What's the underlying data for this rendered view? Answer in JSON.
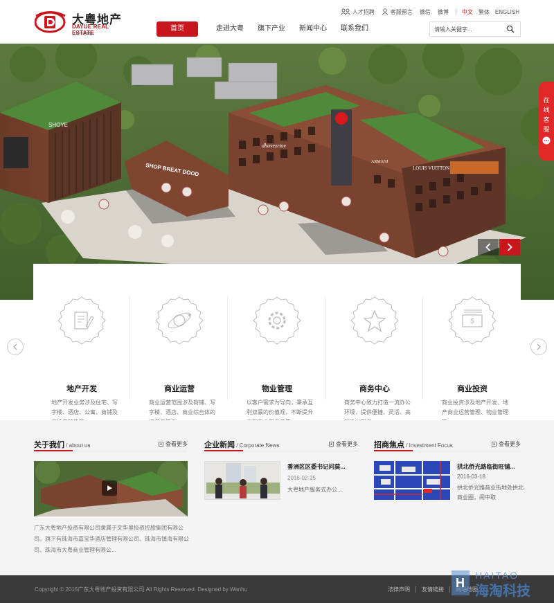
{
  "brand": {
    "name_cn": "大粤地产",
    "name_en": "DAYUE REAL ESTATE",
    "slogan": "让城市更精彩"
  },
  "toplinks": {
    "recruit": "人才招聘",
    "message": "客服留言",
    "wechat": "微信",
    "weibo": "微博",
    "lang_cn": "中文",
    "lang_tw": "繁体",
    "lang_en": "ENGLISH"
  },
  "nav": {
    "items": [
      {
        "label": "首页"
      },
      {
        "label": "走进大粤"
      },
      {
        "label": "旗下产业"
      },
      {
        "label": "新闻中心"
      },
      {
        "label": "联系我们"
      }
    ]
  },
  "search": {
    "placeholder": "请输入关键字..."
  },
  "side_service": {
    "chars": [
      "在",
      "线",
      "客",
      "服"
    ]
  },
  "banner": {
    "signs": {
      "shop": "SHOP BREAT DOOD",
      "store": "SHOYE",
      "lv": "LOUIS VUITTON",
      "armani": "ARMANI",
      "brand": "dhovezrtov"
    }
  },
  "business": [
    {
      "title": "地产开发",
      "desc": "地产开发业务涉及住宅、写字楼、酒店、公寓、商铺及房地产销售等。",
      "icon": "document-pen-icon"
    },
    {
      "title": "商业运营",
      "desc": "商业运营范围涉及商铺、写字楼、酒店、商业综合体的运营与策划。",
      "icon": "orbit-icon"
    },
    {
      "title": "物业管理",
      "desc": "以客户需求为导向，秉承互利双赢的价值观，不断提升高端物业服务品质。",
      "icon": "gear-icon"
    },
    {
      "title": "商务中心",
      "desc": "商务中心致力打造一流办公环境，提供便捷、灵活、高效办公服务。",
      "icon": "star-icon"
    },
    {
      "title": "商业投资",
      "desc": "商业投资涉及地产开发、地产商业运营管理、物业管理等。",
      "icon": "money-icon"
    }
  ],
  "about": {
    "title": "关于我们",
    "title_en": " / about us",
    "more": "查看更多",
    "text": "广东大粤地产投资有限公司隶属于文华里投资控股集团有限公司。旗下有珠海市嘉宝华酒店管理有限公司、珠海市镇海有限公司、珠海市大粤商业管理有限公..."
  },
  "news": {
    "title": "企业新闻",
    "title_en": " / Corporate News",
    "more": "查看更多",
    "item_title": "香洲区区委书记问莫...",
    "item_date": "2016-02-25",
    "item_summary": "大粤地产服务式办公..."
  },
  "focus": {
    "title": "招商焦点",
    "title_en": " / Investment Focus",
    "more": "查看更多",
    "item_title": "拱北侨光路临街旺铺...",
    "item_date": "2016-03-18",
    "item_summary": "拱北侨光路商业街地处拱北商业圈，闹中取"
  },
  "footer": {
    "copyright": "Copyright © 2015广东大粤地产投资有限公司   All Rights Reserved. Designed by Wanhu",
    "legal": "法律声明",
    "friends": "友情链接",
    "sitemap": "网站地图"
  },
  "watermark": {
    "en": "HAITAO",
    "cn": "海淘科技"
  },
  "colors": {
    "accent": "#c8161d",
    "footer": "#3a3a3a",
    "section_bg": "#f4f4f4"
  }
}
